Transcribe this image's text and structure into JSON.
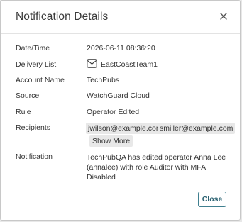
{
  "dialog": {
    "title": "Notification Details",
    "close_icon": "close-icon",
    "close_button_label": "Close"
  },
  "fields": {
    "datetime": {
      "label": "Date/Time",
      "value": "2026-06-11 08:36:20"
    },
    "delivery_list": {
      "label": "Delivery List",
      "value": "EastCoastTeam1",
      "icon": "envelope-icon"
    },
    "account_name": {
      "label": "Account Name",
      "value": "TechPubs"
    },
    "source": {
      "label": "Source",
      "value": "WatchGuard Cloud"
    },
    "rule": {
      "label": "Rule",
      "value": "Operator Edited"
    },
    "recipients": {
      "label": "Recipients",
      "items": [
        "jwilson@example.com",
        "smiller@example.com"
      ],
      "show_more_label": "Show More"
    },
    "notification": {
      "label": "Notification",
      "value": "TechPubQA has edited operator Anna Lee (annalee) with role Auditor with MFA Disabled"
    }
  },
  "colors": {
    "accent": "#2a6171",
    "chip_bg": "#e8e8e8"
  }
}
